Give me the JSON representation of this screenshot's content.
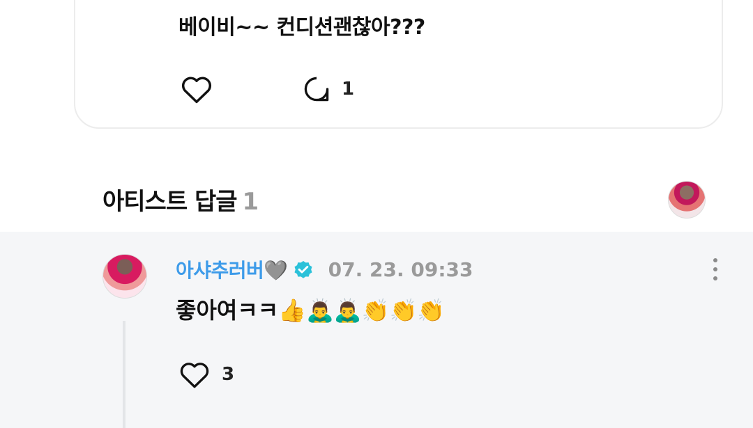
{
  "post": {
    "text": "베이비~~ 컨디션괜찮아???",
    "comment_count": "1"
  },
  "artist_replies": {
    "title": "아티스트 답글",
    "count": "1"
  },
  "reply": {
    "author": "아샤추러버🩶",
    "timestamp": "07. 23. 09:33",
    "text": "좋아여ㅋㅋ👍🙇‍♂️🙇‍♂️👏👏👏",
    "like_count": "3",
    "verified": true
  },
  "colors": {
    "author_name": "#3d9be9",
    "verified_badge": "#2bc1d9",
    "muted_text": "#9a9a9a",
    "reply_background": "#f5f6f8"
  },
  "icons": {
    "like": "heart-icon",
    "comment": "comment-bubble-icon",
    "verified": "verified-badge-icon",
    "more": "more-vertical-icon"
  }
}
